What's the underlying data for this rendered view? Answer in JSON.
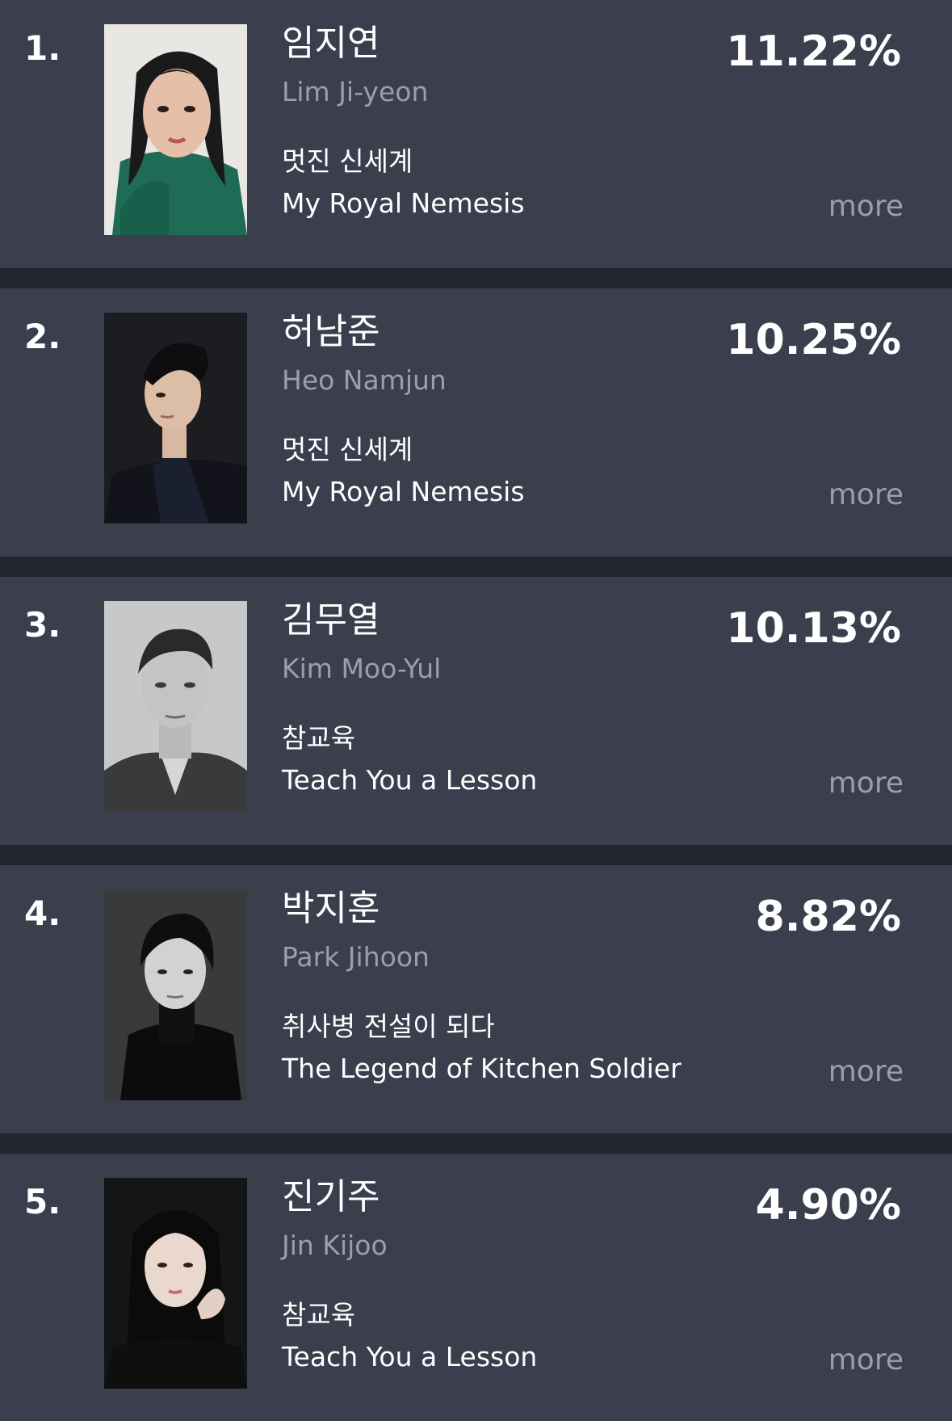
{
  "colors": {
    "background": "#3b3e4d",
    "divider": "#212631",
    "primary_text": "#ffffff",
    "secondary_text": "#9b9eac"
  },
  "ranking": [
    {
      "rank": "1.",
      "name_ko": "임지연",
      "name_en": "Lim Ji-yeon",
      "show_ko": "멋진 신세계",
      "show_en": "My Royal Nemesis",
      "percent": "11.22%",
      "share": 11.22,
      "more": "more",
      "photo": "portrait-photo-green-sweater"
    },
    {
      "rank": "2.",
      "name_ko": "허남준",
      "name_en": "Heo Namjun",
      "show_ko": "멋진 신세계",
      "show_en": "My Royal Nemesis",
      "percent": "10.25%",
      "share": 10.25,
      "more": "more",
      "photo": "portrait-photo-dark-shirt"
    },
    {
      "rank": "3.",
      "name_ko": "김무열",
      "name_en": "Kim Moo-Yul",
      "show_ko": "참교육",
      "show_en": "Teach You a Lesson",
      "percent": "10.13%",
      "share": 10.13,
      "more": "more",
      "photo": "portrait-photo-grayscale-jacket"
    },
    {
      "rank": "4.",
      "name_ko": "박지훈",
      "name_en": "Park Jihoon",
      "show_ko": "취사병 전설이 되다",
      "show_en": "The Legend of Kitchen Soldier",
      "percent": "8.82%",
      "share": 8.82,
      "more": "more",
      "photo": "portrait-photo-black-turtleneck"
    },
    {
      "rank": "5.",
      "name_ko": "진기주",
      "name_en": "Jin Kijoo",
      "show_ko": "참교육",
      "show_en": "Teach You a Lesson",
      "percent": "4.90%",
      "share": 4.9,
      "more": "more",
      "photo": "portrait-photo-hand-on-cheek"
    }
  ]
}
